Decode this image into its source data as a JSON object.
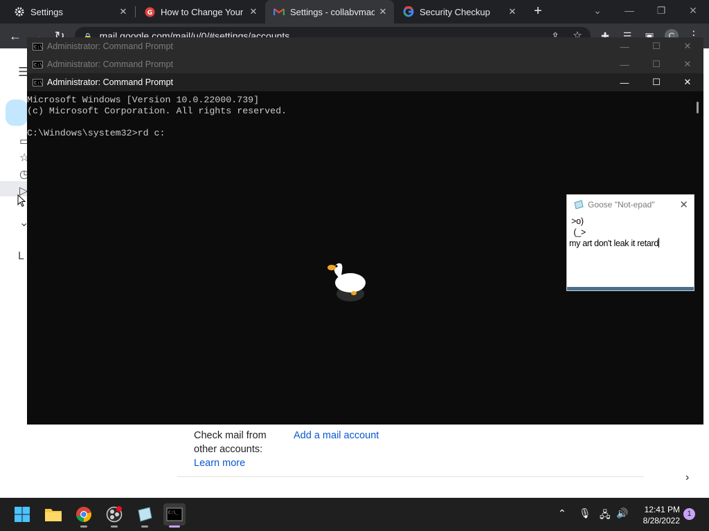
{
  "browser": {
    "tabs": [
      {
        "title": "Settings",
        "icon": "gear-icon",
        "active": false
      },
      {
        "title": "How to Change Your G",
        "icon": "g-logo-icon",
        "active": false
      },
      {
        "title": "Settings - collabvmacc",
        "icon": "gmail-icon",
        "active": true
      },
      {
        "title": "Security Checkup",
        "icon": "google-icon",
        "active": false
      }
    ],
    "url": "mail.google.com/mail/u/0/#settings/accounts",
    "profile_initial": "C"
  },
  "cmd_windows": {
    "back_title_1": "Administrator: Command Prompt",
    "back_title_2": "Administrator: Command Prompt",
    "active_title": "Administrator: Command Prompt",
    "console_lines": "Microsoft Windows [Version 10.0.22000.739]\n(c) Microsoft Corporation. All rights reserved.\n\nC:\\Windows\\system32>rd c:"
  },
  "notepad": {
    "title": "Goose \"Not-epad\"",
    "line1": " >o)",
    "line2": "  (_>",
    "line3": "my art don't leak it retard"
  },
  "gmail": {
    "check_mail_label_1": "Check mail from",
    "check_mail_label_2": "other accounts:",
    "learn_more": "Learn more",
    "add_account": "Add a mail account",
    "side_letter": "L"
  },
  "taskbar": {
    "time": "12:41 PM",
    "date": "8/28/2022",
    "notification_count": "1"
  },
  "colors": {
    "console_bg": "#0c0c0c",
    "console_text": "#cccccc",
    "link": "#0b57d0",
    "taskbar_bg": "#1f1f1f"
  }
}
